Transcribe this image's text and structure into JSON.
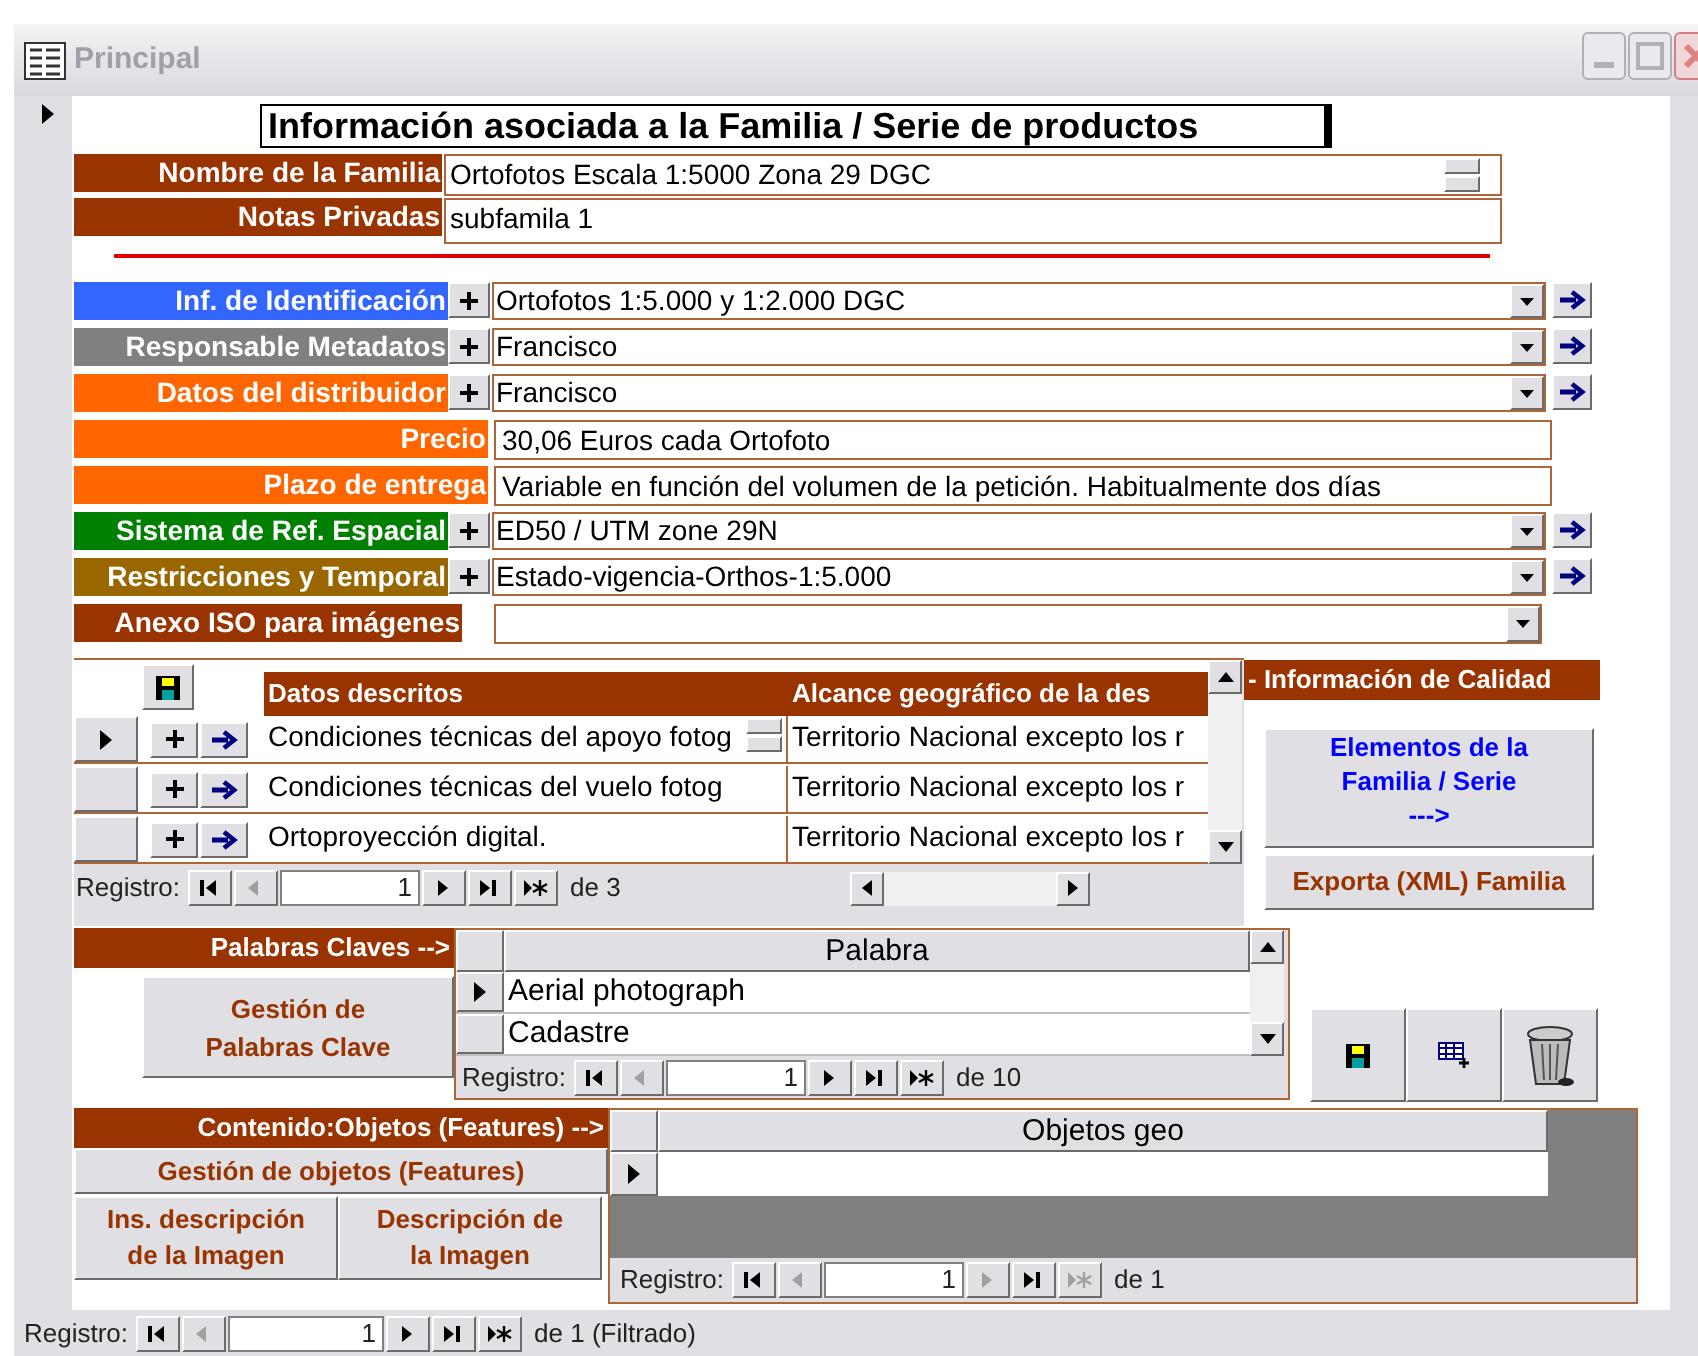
{
  "window": {
    "title": "Principal"
  },
  "form": {
    "record_selected": true,
    "title": "Información asociada a la Familia / Serie de productos",
    "fields": [
      {
        "kind": "memo",
        "label": "Nombre de la Familia",
        "color": "#993300",
        "value": "Ortofotos Escala 1:5000 Zona 29 DGC"
      },
      {
        "kind": "note",
        "label": "Notas Privadas",
        "color": "#993300",
        "value": "subfamila 1"
      },
      {
        "kind": "combo",
        "label": "Inf. de Identificación",
        "color": "#3366ff",
        "value": "Ortofotos 1:5.000 y 1:2.000 DGC"
      },
      {
        "kind": "combo",
        "label": "Responsable Metadatos",
        "color": "#808080",
        "value": "Francisco"
      },
      {
        "kind": "combo",
        "label": "Datos del distribuidor",
        "color": "#ff6600",
        "value": "Francisco"
      },
      {
        "kind": "text",
        "label": "Precio",
        "color": "#ff6600",
        "value": "30,06 Euros cada Ortofoto"
      },
      {
        "kind": "text",
        "label": "Plazo de entrega",
        "color": "#ff6600",
        "value": "Variable en función del volumen de la petición. Habitualmente dos días"
      },
      {
        "kind": "combo",
        "label": "Sistema de Ref. Espacial",
        "color": "#008000",
        "value": "ED50 / UTM zone 29N"
      },
      {
        "kind": "combo",
        "label": "Restricciones y Temporal",
        "color": "#996600",
        "value": "Estado-vigencia-Orthos-1:5.000"
      },
      {
        "kind": "plain_combo",
        "label": "Anexo ISO para imágenes",
        "color": "#993300"
      }
    ]
  },
  "descriptions": {
    "columns": [
      "Datos descritos",
      "Alcance geográfico de la des"
    ],
    "rows": [
      {
        "selected": true,
        "cells": [
          "Condiciones técnicas del apoyo fotog",
          "Territorio Nacional excepto los r"
        ]
      },
      {
        "selected": false,
        "cells": [
          "Condiciones técnicas del vuelo fotog",
          "Territorio Nacional excepto los r"
        ]
      },
      {
        "selected": false,
        "cells": [
          "Ortoproyección digital.",
          "Territorio Nacional excepto los r"
        ]
      }
    ],
    "nav": {
      "label": "Registro:",
      "current": "1",
      "total": "de 3",
      "prev_disabled": true,
      "next_disabled": false
    }
  },
  "quality": {
    "title": "- Información de Calidad",
    "elements_button": [
      "Elementos de la",
      "Familia / Serie",
      "--->"
    ],
    "export_button": "Exporta (XML) Familia"
  },
  "keywords": {
    "label": "Palabras Claves  -->",
    "manage_button": [
      "Gestión de",
      "Palabras Clave"
    ],
    "column": "Palabra",
    "rows": [
      {
        "selected": true,
        "text": "Aerial photograph"
      },
      {
        "selected": false,
        "text": "Cadastre"
      }
    ],
    "nav": {
      "label": "Registro:",
      "current": "1",
      "total": "de 10",
      "prev_disabled": true,
      "next_disabled": false
    }
  },
  "features": {
    "label": "Contenido:Objetos (Features) -->",
    "manage_button": "Gestión de objetos (Features)",
    "buttons": [
      [
        "Ins. descripción",
        "de la Imagen"
      ],
      [
        "Descripción de",
        "la Imagen"
      ]
    ],
    "column": "Objetos geo",
    "new_row_selected": true,
    "nav": {
      "label": "Registro:",
      "current": "1",
      "total": "de 1",
      "prev_disabled": true,
      "next_disabled": true
    }
  },
  "record_nav": {
    "label": "Registro:",
    "current": "1",
    "total": "de 1 (Filtrado)",
    "prev_disabled": true,
    "next_disabled": false
  }
}
